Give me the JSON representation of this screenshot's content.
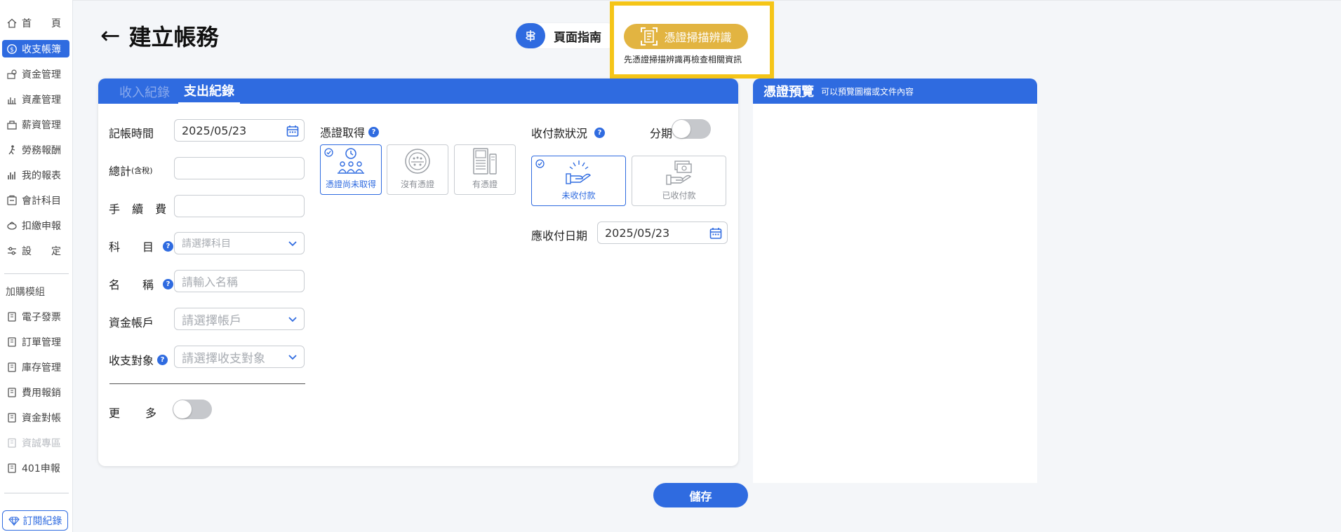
{
  "sidebar": {
    "items": [
      {
        "label": "首　　頁",
        "icon": "home-icon",
        "active": false
      },
      {
        "label": "收支帳簿",
        "icon": "coin-icon",
        "active": true
      },
      {
        "label": "資金管理",
        "icon": "money-icon",
        "active": false
      },
      {
        "label": "資產管理",
        "icon": "asset-icon",
        "active": false
      },
      {
        "label": "薪資管理",
        "icon": "salary-icon",
        "active": false
      },
      {
        "label": "勞務報酬",
        "icon": "labor-icon",
        "active": false
      },
      {
        "label": "我的報表",
        "icon": "report-icon",
        "active": false
      },
      {
        "label": "會計科目",
        "icon": "ledger-icon",
        "active": false
      },
      {
        "label": "扣繳申報",
        "icon": "tax-icon",
        "active": false
      },
      {
        "label": "設　　定",
        "icon": "settings-icon",
        "active": false
      }
    ],
    "addon_section_label": "加購模組",
    "addons": [
      {
        "label": "電子發票",
        "disabled": false
      },
      {
        "label": "訂單管理",
        "disabled": false
      },
      {
        "label": "庫存管理",
        "disabled": false
      },
      {
        "label": "費用報銷",
        "disabled": false
      },
      {
        "label": "資金對帳",
        "disabled": false
      },
      {
        "label": "資誠專區",
        "disabled": true
      },
      {
        "label": "401申報",
        "disabled": false
      }
    ],
    "subscription_label": "訂閱紀錄"
  },
  "header": {
    "back_arrow": "←",
    "title": "建立帳務",
    "guide_label": "頁面指南",
    "scan_label": "憑證掃描辨識",
    "scan_hint": "先憑證掃描辨識再檢查相關資訊"
  },
  "tabs": [
    {
      "label": "收入紀錄",
      "active": false
    },
    {
      "label": "支出紀錄",
      "active": true
    }
  ],
  "form": {
    "date_label": "記帳時間",
    "date_value": "2025/05/23",
    "total_label": "總計",
    "total_suffix": "(含稅)",
    "total_value": "",
    "fee_label": "手 續 費",
    "fee_value": "",
    "subject_label": "科　目",
    "subject_placeholder": "請選擇科目",
    "name_label": "名　稱",
    "name_placeholder": "請輸入名稱",
    "account_label": "資金帳戶",
    "account_placeholder": "請選擇帳戶",
    "target_label": "收支對象",
    "target_placeholder": "請選擇收支對象",
    "more_label": "更　多",
    "more_on": false
  },
  "voucher": {
    "label": "憑證取得",
    "options": [
      {
        "label": "憑證尚未取得",
        "selected": true
      },
      {
        "label": "沒有憑證",
        "selected": false
      },
      {
        "label": "有憑證",
        "selected": false
      }
    ]
  },
  "payment": {
    "label": "收付款狀況",
    "installment_label": "分期",
    "installment_on": false,
    "options": [
      {
        "label": "未收付款",
        "selected": true
      },
      {
        "label": "已收付款",
        "selected": false
      }
    ],
    "due_label": "應收付日期",
    "due_value": "2025/05/23"
  },
  "preview": {
    "title": "憑證預覽",
    "subtitle": "可以預覽圖檔或文件內容"
  },
  "save_label": "儲存",
  "colors": {
    "primary": "#2f6be0",
    "scan": "#e2b441",
    "highlight": "#f5c518"
  }
}
